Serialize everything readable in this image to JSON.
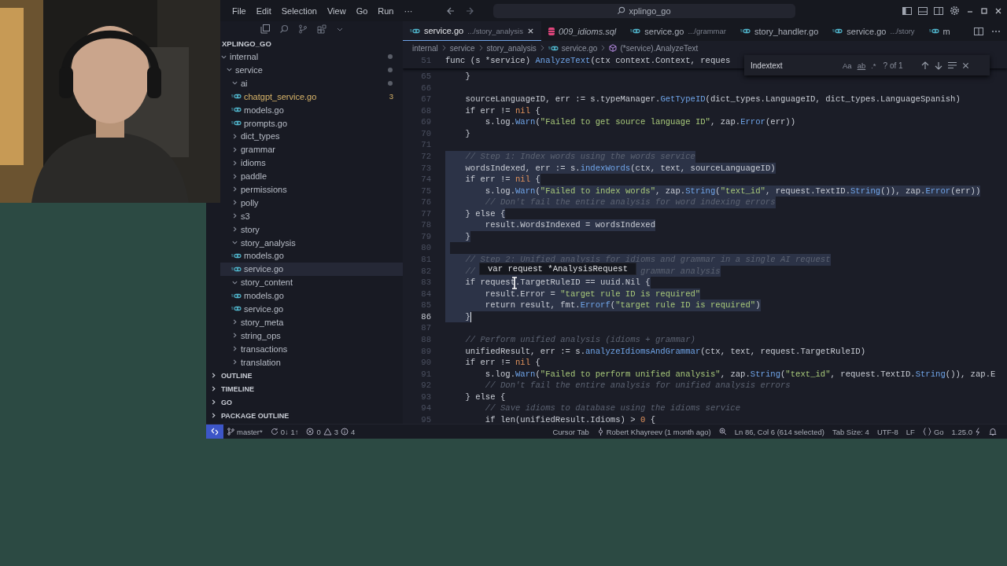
{
  "title_bar": {
    "menu": [
      "File",
      "Edit",
      "Selection",
      "View",
      "Go",
      "Run",
      "···"
    ],
    "search": "xplingo_go"
  },
  "sidebar": {
    "explorer_title": "XPLINGO_GO",
    "tree": [
      {
        "label": "internal",
        "kind": "folder",
        "expanded": true,
        "modified": true,
        "selected": false,
        "children": [
          {
            "label": "service",
            "kind": "folder",
            "expanded": true,
            "modified": true,
            "selected": false,
            "children": [
              {
                "label": "ai",
                "kind": "folder",
                "expanded": true,
                "modified": true,
                "selected": false,
                "children": [
                  {
                    "label": "chatgpt_service.go",
                    "kind": "file",
                    "modified": false,
                    "selected": false,
                    "problems": "3"
                  },
                  {
                    "label": "models.go",
                    "kind": "file",
                    "modified": false,
                    "selected": false
                  },
                  {
                    "label": "prompts.go",
                    "kind": "file",
                    "modified": false,
                    "selected": false
                  }
                ]
              },
              {
                "label": "dict_types",
                "kind": "folder",
                "expanded": false,
                "modified": false,
                "selected": false
              },
              {
                "label": "grammar",
                "kind": "folder",
                "expanded": false,
                "modified": false,
                "selected": false
              },
              {
                "label": "idioms",
                "kind": "folder",
                "expanded": false,
                "modified": false,
                "selected": false
              },
              {
                "label": "paddle",
                "kind": "folder",
                "expanded": false,
                "modified": false,
                "selected": false
              },
              {
                "label": "permissions",
                "kind": "folder",
                "expanded": false,
                "modified": false,
                "selected": false
              },
              {
                "label": "polly",
                "kind": "folder",
                "expanded": false,
                "modified": false,
                "selected": false
              },
              {
                "label": "s3",
                "kind": "folder",
                "expanded": false,
                "modified": false,
                "selected": false
              },
              {
                "label": "story",
                "kind": "folder",
                "expanded": false,
                "modified": false,
                "selected": false
              },
              {
                "label": "story_analysis",
                "kind": "folder",
                "expanded": true,
                "modified": false,
                "selected": false,
                "children": [
                  {
                    "label": "models.go",
                    "kind": "file",
                    "modified": false,
                    "selected": false
                  },
                  {
                    "label": "service.go",
                    "kind": "file",
                    "modified": false,
                    "selected": true
                  }
                ]
              },
              {
                "label": "story_content",
                "kind": "folder",
                "expanded": true,
                "modified": false,
                "selected": false,
                "children": [
                  {
                    "label": "models.go",
                    "kind": "file",
                    "modified": false,
                    "selected": false
                  },
                  {
                    "label": "service.go",
                    "kind": "file",
                    "modified": false,
                    "selected": false
                  }
                ]
              },
              {
                "label": "story_meta",
                "kind": "folder",
                "expanded": false,
                "modified": false,
                "selected": false
              },
              {
                "label": "string_ops",
                "kind": "folder",
                "expanded": false,
                "modified": false,
                "selected": false
              },
              {
                "label": "transactions",
                "kind": "folder",
                "expanded": false,
                "modified": false,
                "selected": false
              },
              {
                "label": "translation",
                "kind": "folder",
                "expanded": false,
                "modified": false,
                "selected": false
              }
            ]
          }
        ]
      }
    ],
    "panels": [
      {
        "label": "OUTLINE",
        "expanded": false
      },
      {
        "label": "TIMELINE",
        "expanded": false
      },
      {
        "label": "GO",
        "expanded": false
      },
      {
        "label": "PACKAGE OUTLINE",
        "expanded": false
      }
    ]
  },
  "tabs": [
    {
      "name": "service.go",
      "path": ".../story_analysis",
      "kind": "go",
      "selected": true
    },
    {
      "name": "009_idioms.sql",
      "kind": "sql",
      "selected": false
    },
    {
      "name": "service.go",
      "path": ".../grammar",
      "kind": "go",
      "selected": false
    },
    {
      "name": "story_handler.go",
      "kind": "go",
      "selected": false
    },
    {
      "name": "service.go",
      "path": ".../story",
      "kind": "go",
      "selected": false
    },
    {
      "name": "m",
      "kind": "go",
      "selected": false
    }
  ],
  "breadcrumb": [
    "internal",
    "service",
    "story_analysis",
    "service.go",
    "(*service).AnalyzeText"
  ],
  "find": {
    "value": "Indextext",
    "options": [
      "Aa",
      "ab",
      ".*"
    ],
    "result": "? of 1"
  },
  "sticky_line": {
    "n": "51",
    "tokens": [
      {
        "kind": "t",
        "text": "func (s *service) "
      },
      {
        "kind": "f",
        "text": "AnalyzeText"
      },
      {
        "kind": "t",
        "text": "(ctx context.Context, reques"
      }
    ]
  },
  "lines": [
    {
      "n": "65",
      "sel": false,
      "cur": false,
      "tokens": [
        {
          "kind": "t",
          "text": "    }"
        }
      ]
    },
    {
      "n": "66",
      "sel": false,
      "cur": false
    },
    {
      "n": "67",
      "sel": false,
      "cur": false,
      "tokens": [
        {
          "kind": "t",
          "text": "    sourceLanguageID, err := s.typeManager."
        },
        {
          "kind": "f",
          "text": "GetTypeID"
        },
        {
          "kind": "t",
          "text": "(dict_types.LanguageID, dict_types.LanguageSpanish)"
        }
      ]
    },
    {
      "n": "68",
      "sel": false,
      "cur": false,
      "tokens": [
        {
          "kind": "t",
          "text": "    if err != "
        },
        {
          "kind": "k",
          "text": "nil"
        },
        {
          "kind": "t",
          "text": " {"
        }
      ]
    },
    {
      "n": "69",
      "sel": false,
      "cur": false,
      "tokens": [
        {
          "kind": "t",
          "text": "        s.log."
        },
        {
          "kind": "f",
          "text": "Warn"
        },
        {
          "kind": "t",
          "text": "("
        },
        {
          "kind": "s",
          "text": "\"Failed to get source language ID\""
        },
        {
          "kind": "t",
          "text": ", zap."
        },
        {
          "kind": "f",
          "text": "Error"
        },
        {
          "kind": "t",
          "text": "(err))"
        }
      ]
    },
    {
      "n": "70",
      "sel": false,
      "cur": false,
      "tokens": [
        {
          "kind": "t",
          "text": "    }"
        }
      ]
    },
    {
      "n": "71",
      "sel": false,
      "cur": false
    },
    {
      "n": "72",
      "sel": true,
      "cur": false,
      "tokens": [
        {
          "kind": "c",
          "text": "    // Step 1: Index words using the words service"
        }
      ]
    },
    {
      "n": "73",
      "sel": true,
      "cur": false,
      "tokens": [
        {
          "kind": "t",
          "text": "    wordsIndexed, err := s."
        },
        {
          "kind": "f",
          "text": "indexWords"
        },
        {
          "kind": "t",
          "text": "(ctx, text, sourceLanguageID)"
        }
      ]
    },
    {
      "n": "74",
      "sel": true,
      "cur": false,
      "tokens": [
        {
          "kind": "t",
          "text": "    if err != "
        },
        {
          "kind": "k",
          "text": "nil"
        },
        {
          "kind": "t",
          "text": " {"
        }
      ]
    },
    {
      "n": "75",
      "sel": true,
      "cur": false,
      "tokens": [
        {
          "kind": "t",
          "text": "        s.log."
        },
        {
          "kind": "f",
          "text": "Warn"
        },
        {
          "kind": "t",
          "text": "("
        },
        {
          "kind": "s",
          "text": "\"Failed to index words\""
        },
        {
          "kind": "t",
          "text": ", zap."
        },
        {
          "kind": "f",
          "text": "String"
        },
        {
          "kind": "t",
          "text": "("
        },
        {
          "kind": "s",
          "text": "\"text_id\""
        },
        {
          "kind": "t",
          "text": ", request.TextID."
        },
        {
          "kind": "f",
          "text": "String"
        },
        {
          "kind": "t",
          "text": "()), zap."
        },
        {
          "kind": "f",
          "text": "Error"
        },
        {
          "kind": "t",
          "text": "(err))"
        }
      ]
    },
    {
      "n": "76",
      "sel": true,
      "cur": false,
      "tokens": [
        {
          "kind": "c",
          "text": "        // Don't fail the entire analysis for word indexing errors"
        }
      ]
    },
    {
      "n": "77",
      "sel": true,
      "cur": false,
      "tokens": [
        {
          "kind": "t",
          "text": "    } else {"
        }
      ]
    },
    {
      "n": "78",
      "sel": true,
      "cur": false,
      "tokens": [
        {
          "kind": "t",
          "text": "        result.WordsIndexed = wordsIndexed"
        }
      ]
    },
    {
      "n": "79",
      "sel": true,
      "cur": false,
      "tokens": [
        {
          "kind": "t",
          "text": "    }"
        }
      ]
    },
    {
      "n": "80",
      "sel": true,
      "cur": false
    },
    {
      "n": "81",
      "sel": true,
      "cur": false,
      "tokens": [
        {
          "kind": "c",
          "text": "    // Step 2: Unified analysis for idioms and grammar in a single AI request"
        }
      ]
    },
    {
      "n": "82",
      "sel": true,
      "cur": false,
      "tokens": [
        {
          "kind": "c",
          "text": "    //                                 grammar analysis"
        }
      ]
    },
    {
      "n": "83",
      "sel": true,
      "cur": false,
      "tokens": [
        {
          "kind": "t",
          "text": "    if request.TargetRuleID == uuid.Nil {"
        }
      ]
    },
    {
      "n": "84",
      "sel": true,
      "cur": false,
      "tokens": [
        {
          "kind": "t",
          "text": "        result.Error = "
        },
        {
          "kind": "s",
          "text": "\"target rule ID is required\""
        }
      ]
    },
    {
      "n": "85",
      "sel": true,
      "cur": false,
      "tokens": [
        {
          "kind": "t",
          "text": "        return result, fmt."
        },
        {
          "kind": "f",
          "text": "Errorf"
        },
        {
          "kind": "t",
          "text": "("
        },
        {
          "kind": "s",
          "text": "\"target rule ID is required\""
        },
        {
          "kind": "t",
          "text": ")"
        }
      ]
    },
    {
      "n": "86",
      "sel": true,
      "cur": true,
      "tokens": [
        {
          "kind": "t",
          "text": "    }"
        }
      ]
    },
    {
      "n": "87",
      "sel": false,
      "cur": false
    },
    {
      "n": "88",
      "sel": false,
      "cur": false,
      "tokens": [
        {
          "kind": "c",
          "text": "    // Perform unified analysis (idioms + grammar)"
        }
      ]
    },
    {
      "n": "89",
      "sel": false,
      "cur": false,
      "tokens": [
        {
          "kind": "t",
          "text": "    unifiedResult, err := s."
        },
        {
          "kind": "f",
          "text": "analyzeIdiomsAndGrammar"
        },
        {
          "kind": "t",
          "text": "(ctx, text, request.TargetRuleID)"
        }
      ]
    },
    {
      "n": "90",
      "sel": false,
      "cur": false,
      "tokens": [
        {
          "kind": "t",
          "text": "    if err != "
        },
        {
          "kind": "k",
          "text": "nil"
        },
        {
          "kind": "t",
          "text": " {"
        }
      ]
    },
    {
      "n": "91",
      "sel": false,
      "cur": false,
      "tokens": [
        {
          "kind": "t",
          "text": "        s.log."
        },
        {
          "kind": "f",
          "text": "Warn"
        },
        {
          "kind": "t",
          "text": "("
        },
        {
          "kind": "s",
          "text": "\"Failed to perform unified analysis\""
        },
        {
          "kind": "t",
          "text": ", zap."
        },
        {
          "kind": "f",
          "text": "String"
        },
        {
          "kind": "t",
          "text": "("
        },
        {
          "kind": "s",
          "text": "\"text_id\""
        },
        {
          "kind": "t",
          "text": ", request.TextID."
        },
        {
          "kind": "f",
          "text": "String"
        },
        {
          "kind": "t",
          "text": "()), zap.E"
        }
      ]
    },
    {
      "n": "92",
      "sel": false,
      "cur": false,
      "tokens": [
        {
          "kind": "c",
          "text": "        // Don't fail the entire analysis for unified analysis errors"
        }
      ]
    },
    {
      "n": "93",
      "sel": false,
      "cur": false,
      "tokens": [
        {
          "kind": "t",
          "text": "    } else {"
        }
      ]
    },
    {
      "n": "94",
      "sel": false,
      "cur": false,
      "tokens": [
        {
          "kind": "c",
          "text": "        // Save idioms to database using the idioms service"
        }
      ]
    },
    {
      "n": "95",
      "sel": false,
      "cur": false,
      "tokens": [
        {
          "kind": "t",
          "text": "        if len(unifiedResult.Idioms) > "
        },
        {
          "kind": "k",
          "text": "0"
        },
        {
          "kind": "t",
          "text": " {"
        }
      ]
    }
  ],
  "hover": {
    "text": "var request *AnalysisRequest"
  },
  "status_bar": {
    "branch": "master*",
    "sync": "0↓ 1↑",
    "errors": "0",
    "warnings": "3",
    "info": "4",
    "right": [
      {
        "kind": "text",
        "text": "Cursor Tab"
      },
      {
        "kind": "blame",
        "text": "Robert Khayreev (1 month ago)"
      },
      {
        "kind": "zoom"
      },
      {
        "kind": "text",
        "text": "Ln 86, Col 6 (614 selected)"
      },
      {
        "kind": "text",
        "text": "Tab Size: 4"
      },
      {
        "kind": "text",
        "text": "UTF-8"
      },
      {
        "kind": "text",
        "text": "LF"
      },
      {
        "kind": "lang",
        "text": "Go"
      },
      {
        "kind": "version",
        "text": "1.25.0"
      },
      {
        "kind": "bell"
      }
    ]
  }
}
